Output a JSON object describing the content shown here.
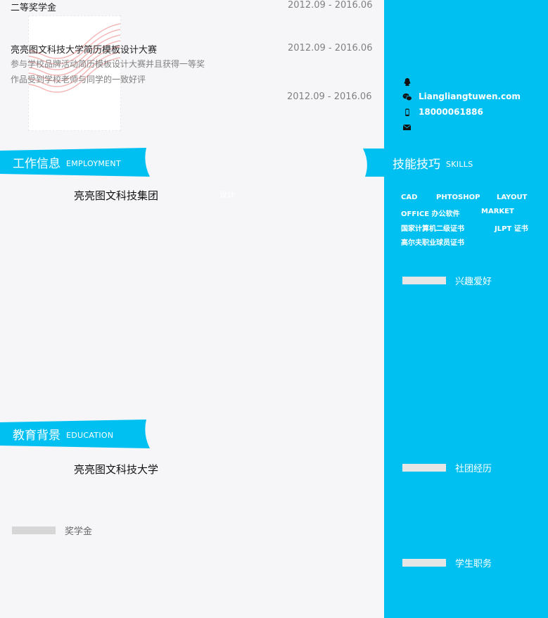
{
  "awards": [
    {
      "title": "二等奖学金",
      "date": "2012.09 - 2016.06"
    },
    {
      "title": "亮亮图文科技大学简历模板设计大赛",
      "date": "2012.09 - 2016.06",
      "description": [
        "参与学校品牌活动简历模板设计大赛并且获得一等奖",
        "作品受到学校老师与同学的一致好评"
      ]
    },
    {
      "title": "",
      "date": "2012.09 - 2016.06"
    }
  ],
  "employment": {
    "title": "工作信息",
    "title_en": "EMPLOYMENT",
    "company": "亮亮图文科技集团",
    "ghost": "设计"
  },
  "education": {
    "title": "教育背景",
    "title_en": "EDUCATION",
    "school": "亮亮图文科技大学"
  },
  "scholarship": {
    "label": "奖学金"
  },
  "contact": {
    "qq": "",
    "wechat": "Liangliangtuwen.com",
    "phone": "18000061886",
    "email": ""
  },
  "skills": {
    "title": "技能技巧",
    "title_en": "SKILLS",
    "items": [
      "CAD",
      "PHTOSHOP",
      "LAYOUT",
      "OFFICE 办公软件",
      "MARKET",
      "国家计算机二级证书",
      "JLPT 证书",
      "高尔夫职业球员证书"
    ]
  },
  "hobbies": {
    "label": "兴趣爱好"
  },
  "clubs": {
    "label": "社团经历"
  },
  "roles": {
    "label": "学生职务"
  },
  "colors": {
    "accent": "#00c0f2",
    "page": "#f6f6f9"
  }
}
